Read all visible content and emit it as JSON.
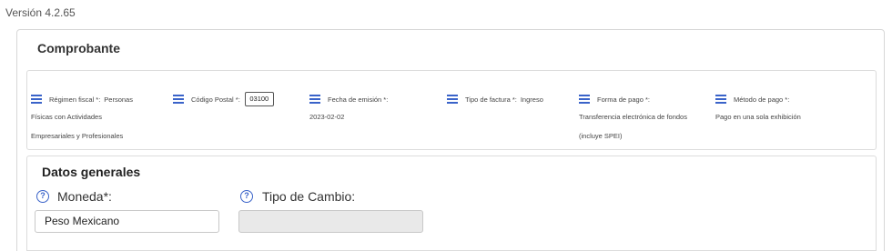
{
  "version": "Versión 4.2.65",
  "comprobante": {
    "title": "Comprobante",
    "fields": [
      {
        "label": "Régimen fiscal *:",
        "value_inline": "Personas",
        "value_lines": [
          "Físicas con Actividades",
          "Empresariales y Profesionales"
        ]
      },
      {
        "label": "Código Postal *:",
        "input_value": "03100"
      },
      {
        "label": "Fecha de emisión *:",
        "value_lines": [
          "2023-02-02"
        ]
      },
      {
        "label": "Tipo de factura *:",
        "value_inline": "Ingreso"
      },
      {
        "label": "Forma de pago *:",
        "value_lines": [
          "Transferencia electrónica de fondos",
          "(incluye SPEI)"
        ]
      },
      {
        "label": "Método de pago *:",
        "value_lines": [
          "Pago en una sola exhibición"
        ]
      }
    ]
  },
  "datos": {
    "title": "Datos generales",
    "moneda_label": "Moneda*:",
    "moneda_value": "Peso Mexicano",
    "tipo_cambio_label": "Tipo de Cambio:",
    "tipo_cambio_value": ""
  },
  "icons": {
    "field_icon": "hamburger-list-icon",
    "help_icon": "question-circle-icon"
  },
  "colors": {
    "accent": "#3a63c9"
  }
}
